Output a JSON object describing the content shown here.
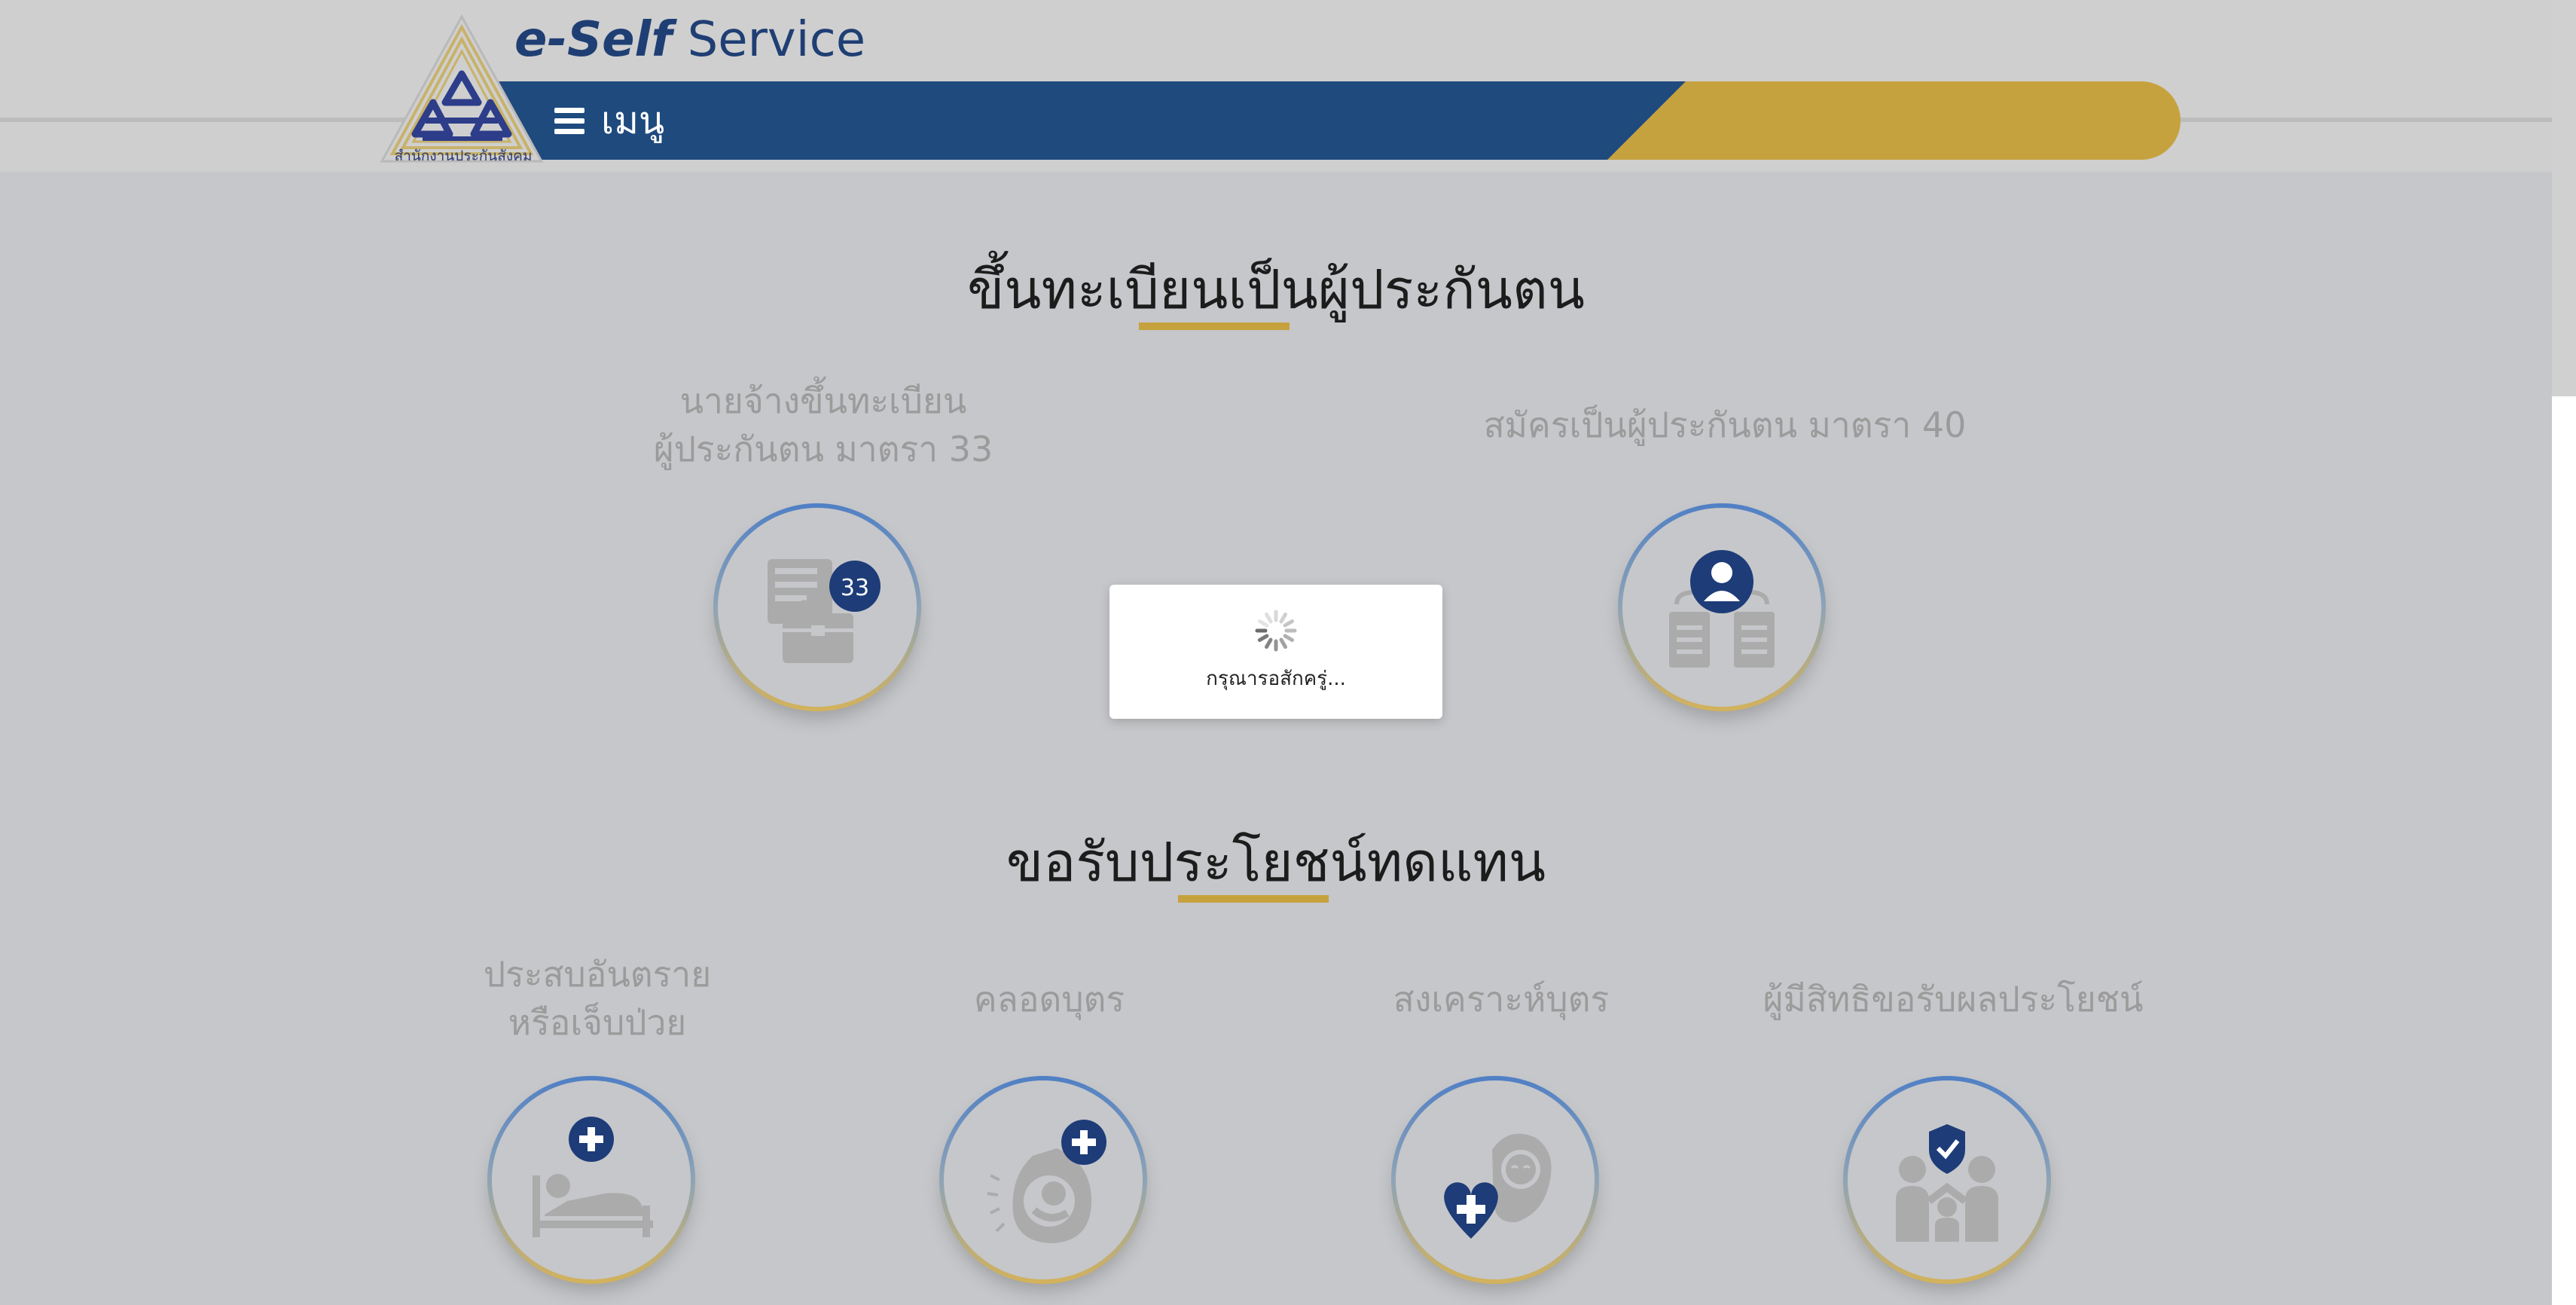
{
  "header": {
    "logo_caption": "สำนักงานประกันสังคม",
    "brand_bold": "e-Self",
    "brand_light": " Service",
    "menu_label": "เมนู"
  },
  "sections": [
    {
      "title": "ขึ้นทะเบียนเป็นผู้ประกันตน",
      "items": [
        {
          "label_line1": "นายจ้างขึ้นทะเบียน",
          "label_line2": "ผู้ประกันตน มาตรา 33",
          "icon": "briefcase-33-icon",
          "badge": "33"
        },
        {
          "label_line1": "สมัครเป็นผู้ประกันตน มาตรา 40",
          "label_line2": "",
          "icon": "person-documents-icon"
        }
      ]
    },
    {
      "title": "ขอรับประโยชน์ทดแทน",
      "items": [
        {
          "label_line1": "ประสบอันตราย",
          "label_line2": "หรือเจ็บป่วย",
          "icon": "patient-bed-icon"
        },
        {
          "label_line1": "คลอดบุตร",
          "label_line2": "",
          "icon": "pregnancy-icon"
        },
        {
          "label_line1": "สงเคราะห์บุตร",
          "label_line2": "",
          "icon": "child-welfare-icon"
        },
        {
          "label_line1": "ผู้มีสิทธิขอรับผลประโยชน์",
          "label_line2": "",
          "icon": "family-shield-icon"
        }
      ]
    }
  ],
  "loading": {
    "message": "กรุณารอสักครู่...",
    "icon": "spinner-icon"
  },
  "colors": {
    "primary_blue": "#1f4a7e",
    "accent_gold": "#c6a23e",
    "icon_navy": "#1d3c78",
    "icon_gray": "#a8a8a8"
  }
}
